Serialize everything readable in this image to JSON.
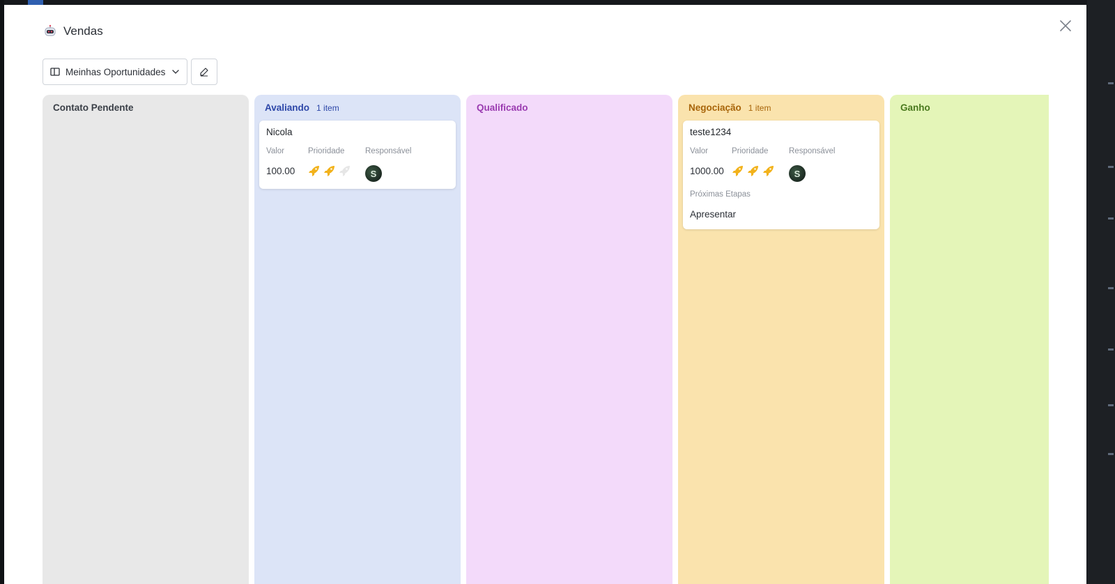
{
  "modal": {
    "title": "Vendas",
    "app_icon": "robot-icon",
    "close_icon": "close-icon"
  },
  "toolbar": {
    "view_label": "Meinhas Oportunidades",
    "view_icon": "columns-icon",
    "dropdown_icon": "chevron-down-icon",
    "edit_icon": "pen-icon"
  },
  "columns": [
    {
      "title": "Contato Pendente",
      "count": "",
      "title_color": "#3a3f47",
      "bg": "#e8e8e8"
    },
    {
      "title": "Avaliando",
      "count": "1 item",
      "title_color": "#2d47a8",
      "bg": "#dce4f7"
    },
    {
      "title": "Qualificado",
      "count": "",
      "title_color": "#9a3bb0",
      "bg": "#f3dafa"
    },
    {
      "title": "Negociação",
      "count": "1 item",
      "title_color": "#a8650a",
      "bg": "#fae3ad"
    },
    {
      "title": "Ganho",
      "count": "",
      "title_color": "#4a7a1e",
      "bg": "#e4f5b8"
    }
  ],
  "cards": {
    "avaliando": {
      "title": "Nicola",
      "valor_label": "Valor",
      "valor": "100.00",
      "prioridade_label": "Prioridade",
      "prioridade": 2,
      "prioridade_max": 3,
      "responsavel_label": "Responsável",
      "avatar_letter": "S"
    },
    "negociacao": {
      "title": "teste1234",
      "valor_label": "Valor",
      "valor": "1000.00",
      "prioridade_label": "Prioridade",
      "prioridade": 3,
      "prioridade_max": 3,
      "responsavel_label": "Responsável",
      "avatar_letter": "S",
      "proximas_label": "Próximas Etapas",
      "proximas": "Apresentar"
    }
  },
  "colors": {
    "rocket_on": "#f2b21b",
    "rocket_off": "#e6e6e6"
  }
}
